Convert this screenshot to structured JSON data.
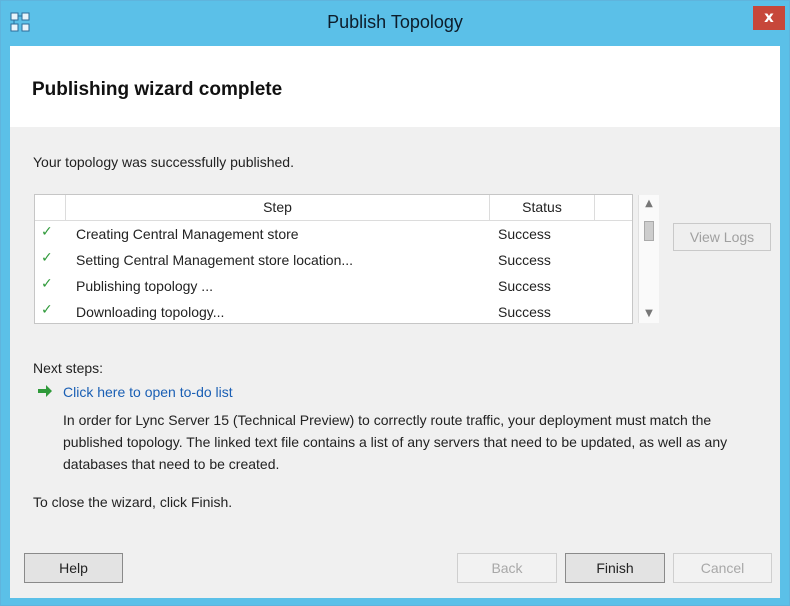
{
  "window": {
    "title": "Publish Topology",
    "close_symbol": "x"
  },
  "header": {
    "title": "Publishing wizard complete"
  },
  "intro": "Your topology was successfully published.",
  "table": {
    "columns": [
      "",
      "Step",
      "Status"
    ],
    "rows": [
      {
        "check": "✓",
        "step": "Creating Central Management store",
        "status": "Success"
      },
      {
        "check": "✓",
        "step": "Setting Central Management store location...",
        "status": "Success"
      },
      {
        "check": "✓",
        "step": "Publishing topology ...",
        "status": "Success"
      },
      {
        "check": "✓",
        "step": "Downloading topology...",
        "status": "Success"
      }
    ]
  },
  "view_logs_label": "View Logs",
  "next_steps": {
    "label": "Next steps:",
    "link_text": "Click here to open to-do list",
    "description": "In order for Lync Server 15 (Technical Preview) to correctly route traffic, your deployment must match the published topology. The linked text file contains a list of any servers that need to be updated, as well as any databases that need to be created."
  },
  "close_note": "To close the wizard, click Finish.",
  "buttons": {
    "help": "Help",
    "back": "Back",
    "finish": "Finish",
    "cancel": "Cancel"
  },
  "icons": {
    "app": "topology-app-icon",
    "close": "close-icon",
    "check": "checkmark-icon",
    "arrow": "green-arrow-icon",
    "scroll_up": "scroll-up-icon",
    "scroll_down": "scroll-down-icon"
  },
  "colors": {
    "titlebar": "#5bc0e8",
    "close": "#c7473a",
    "link": "#1a5fb4",
    "check": "#2f9a3a"
  }
}
